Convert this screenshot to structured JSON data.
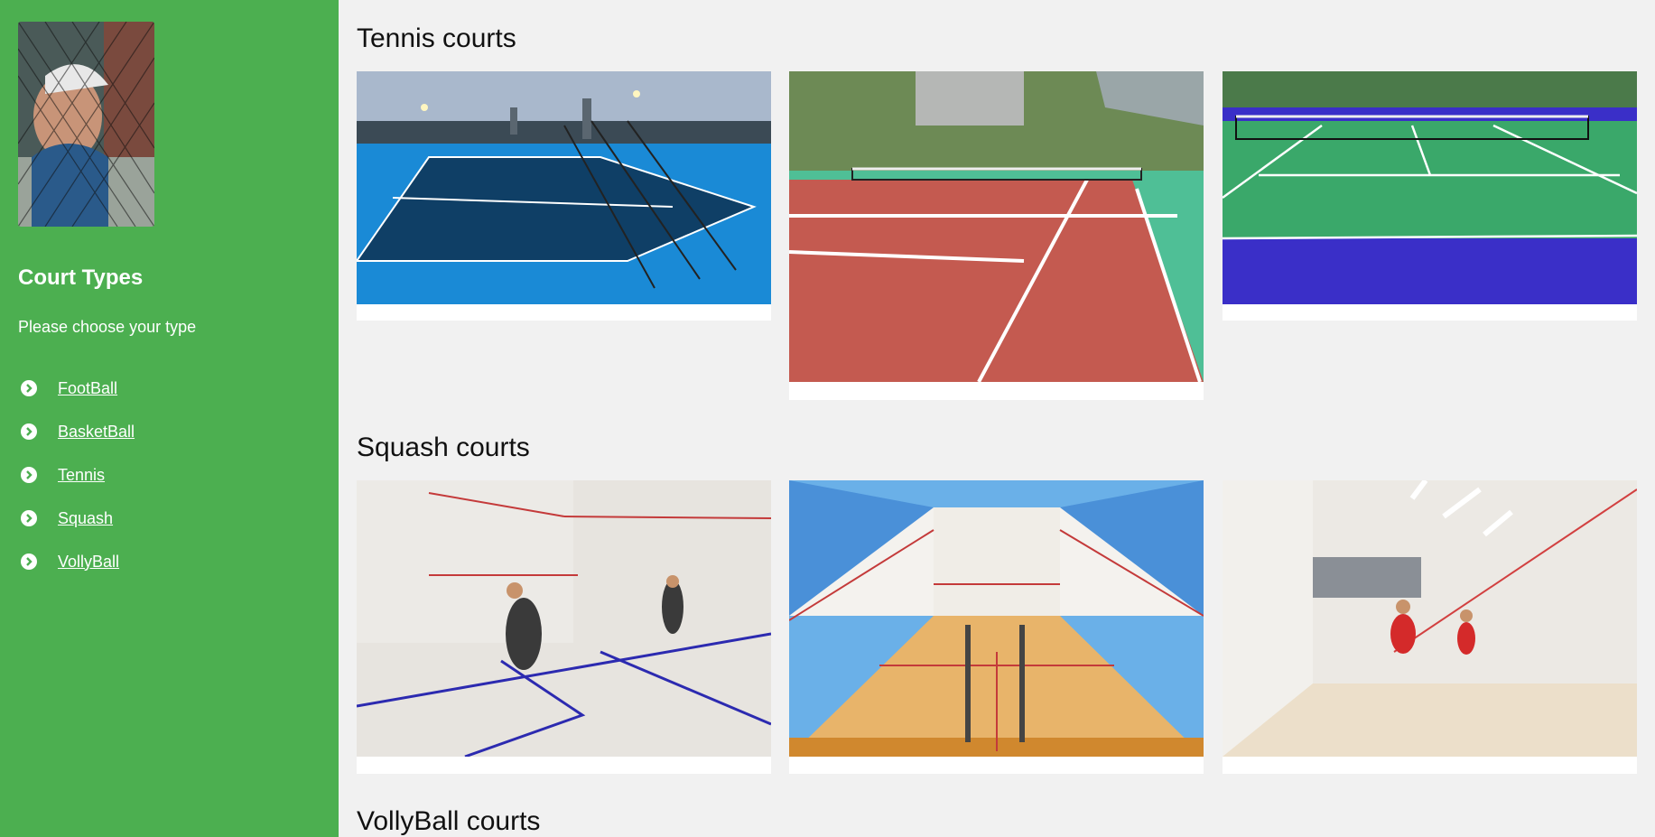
{
  "sidebar": {
    "title": "Court Types",
    "subtitle": "Please choose your type",
    "menu": [
      {
        "label": "FootBall"
      },
      {
        "label": "BasketBall"
      },
      {
        "label": "Tennis"
      },
      {
        "label": "Squash"
      },
      {
        "label": "VollyBall"
      }
    ]
  },
  "sections": [
    {
      "title": "Tennis courts"
    },
    {
      "title": "Squash courts"
    },
    {
      "title": "VollyBall courts"
    }
  ],
  "colors": {
    "sidebar": "#4caf50",
    "page_background": "#f1f1f1"
  }
}
